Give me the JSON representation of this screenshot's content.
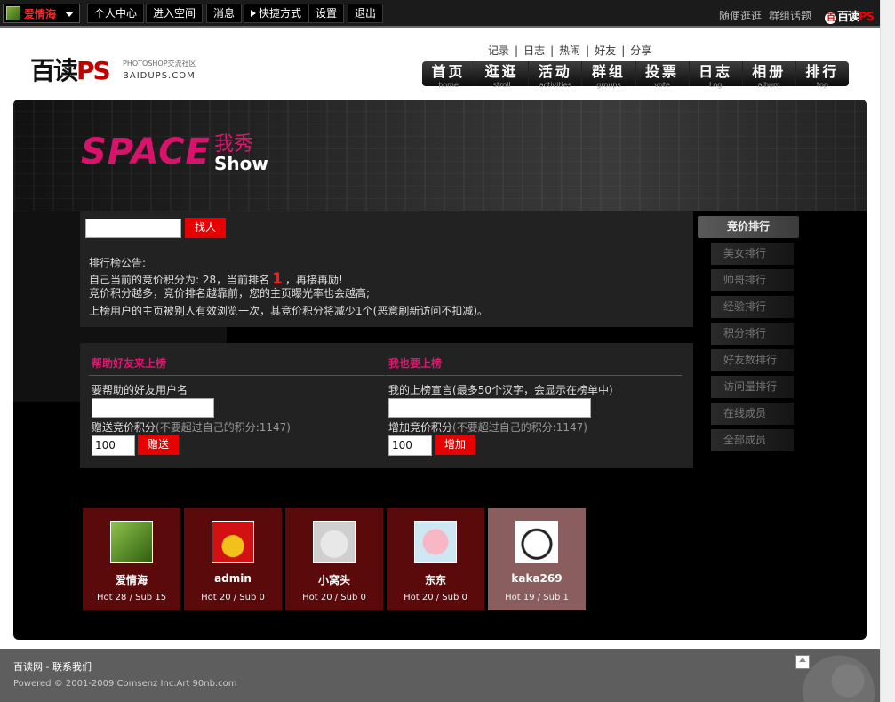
{
  "topbar": {
    "username": "爱情海",
    "links": [
      "个人中心",
      "进入空间",
      "消息",
      "快捷方式",
      "设置",
      "退出"
    ],
    "right_links": [
      "随便逛逛",
      "群组话题"
    ],
    "logo_text": "百读",
    "logo_ps": "PS"
  },
  "header": {
    "logo_main": "百读",
    "logo_ps": "PS",
    "logo_sub": "PHOTOSHOP交流社区",
    "logo_domain": "BAIDUPS.COM",
    "subnav": [
      "记录",
      "日志",
      "热闹",
      "好友",
      "分享"
    ],
    "mainnav": [
      {
        "label": "首页",
        "en": "home"
      },
      {
        "label": "逛逛",
        "en": "stroll"
      },
      {
        "label": "活动",
        "en": "activities"
      },
      {
        "label": "群组",
        "en": "groups"
      },
      {
        "label": "投票",
        "en": "vote"
      },
      {
        "label": "日志",
        "en": "Log"
      },
      {
        "label": "相册",
        "en": "album"
      },
      {
        "label": "排行",
        "en": "top"
      }
    ]
  },
  "banner": {
    "space": "SPACE",
    "cn": "我秀",
    "show": "Show"
  },
  "search": {
    "value": "",
    "button": "找人"
  },
  "announce": {
    "title": "排行榜公告:",
    "line1_pre": "自己当前的竞价积分为: 28，当前排名",
    "rank": "1",
    "line1_post": "，再接再励!",
    "line2": "竞价积分越多，竞价排名越靠前，您的主页曝光率也会越高;",
    "line3": "上榜用户的主页被别人有效浏览一次，其竞价积分将减少1个(恶意刷新访问不扣减)。"
  },
  "help_form": {
    "title": "帮助好友来上榜",
    "friend_label": "要帮助的好友用户名",
    "friend_value": "",
    "credit_label": "赠送竞价积分",
    "credit_hint": "(不要超过自己的积分:1147)",
    "credit_value": "100",
    "button": "赠送"
  },
  "self_form": {
    "title": "我也要上榜",
    "decl_label": "我的上榜宣言",
    "decl_hint": "(最多50个汉字，会显示在榜单中)",
    "decl_value": "",
    "credit_label": "增加竞价积分",
    "credit_hint": "(不要超过自己的积分:1147)",
    "credit_value": "100",
    "button": "增加"
  },
  "rank_tabs": [
    "竞价排行",
    "美女排行",
    "帅哥排行",
    "经验排行",
    "积分排行",
    "好友数排行",
    "访问量排行",
    "在线成员",
    "全部成员"
  ],
  "users": [
    {
      "name": "爱情海",
      "stat": "Hot 28 / Sub 15",
      "pic": "green-face-avatar"
    },
    {
      "name": "admin",
      "stat": "Hot 20 / Sub 0",
      "pic": "rabbit-avatar"
    },
    {
      "name": "小窝头",
      "stat": "Hot 20 / Sub 0",
      "pic": "cat-avatar"
    },
    {
      "name": "东东",
      "stat": "Hot 20 / Sub 0",
      "pic": "pink-girl-avatar"
    },
    {
      "name": "kaka269",
      "stat": "Hot 19 / Sub 1",
      "pic": "cartoon-cat-avatar"
    }
  ],
  "footer": {
    "site": "百读网",
    "sep": " - ",
    "contact": "联系我们",
    "copyright": "Powered © 2001-2009 Comsenz Inc.Art 90nb.com"
  },
  "colors": {
    "accent_red": "#e60000",
    "pink": "#e0166f",
    "card_bg": "#5b0a0c",
    "card_selected": "#8a5e5f"
  }
}
